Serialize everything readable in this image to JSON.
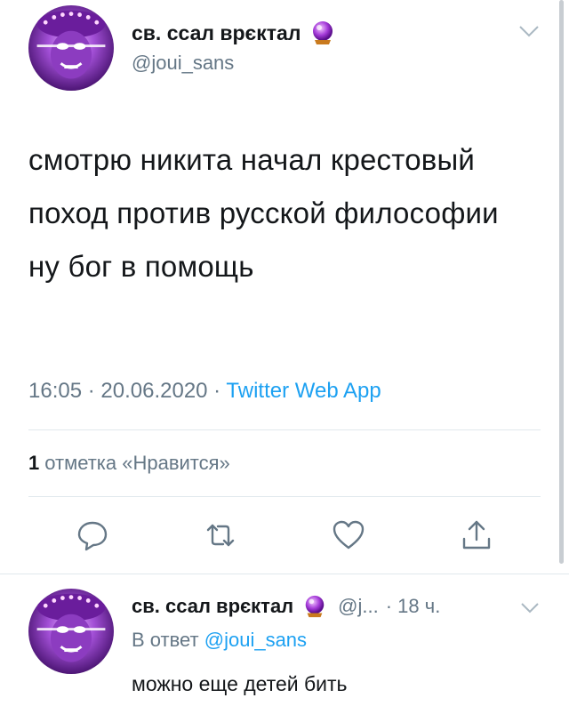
{
  "main_tweet": {
    "display_name": "св. ссал врєктал",
    "handle": "@joui_sans",
    "text": "смотрю никита начал крестовый поход против русской философии ну бог в помощь",
    "time": "16:05",
    "date": "20.06.2020",
    "source": "Twitter Web App",
    "likes_count": "1",
    "likes_label": "отметка «Нравится»",
    "meta_sep1": " · ",
    "meta_sep2": " · "
  },
  "actions": {
    "reply_icon": "speech-bubble",
    "retweet_icon": "retweet-arrows",
    "like_icon": "heart",
    "share_icon": "share-arrow"
  },
  "reply_tweet": {
    "display_name": "св. ссал врєктал",
    "handle": "@j...",
    "time": "· 18 ч.",
    "reply_prefix": "В ответ ",
    "reply_mention": "@joui_sans",
    "text": "можно еще детей бить"
  },
  "colors": {
    "text": "#14171a",
    "secondary": "#657786",
    "accent": "#1da1f2",
    "divider": "#e1e8ed"
  }
}
